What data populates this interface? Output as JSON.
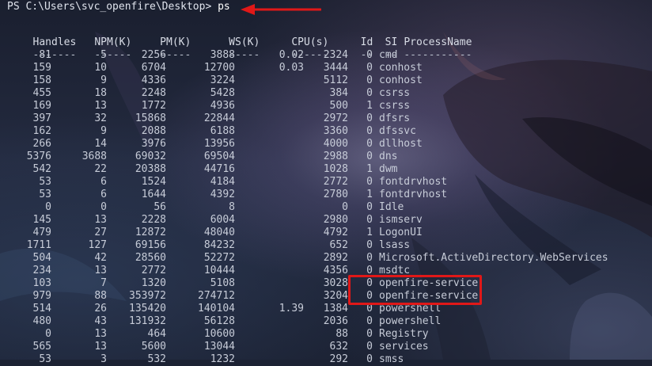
{
  "terminal": {
    "prompt": "PS C:\\Users\\svc_openfire\\Desktop>",
    "command": "ps"
  },
  "table": {
    "headers": [
      "Handles",
      "NPM(K)",
      "PM(K)",
      "WS(K)",
      "CPU(s)",
      "Id",
      "SI",
      "ProcessName"
    ],
    "separators": [
      "-------",
      "------",
      "-----",
      "-----",
      "------",
      "--",
      "--",
      "-----------"
    ],
    "rows": [
      [
        "81",
        "5",
        "2256",
        "3888",
        "0.02",
        "2324",
        "0",
        "cmd"
      ],
      [
        "159",
        "10",
        "6704",
        "12700",
        "0.03",
        "3444",
        "0",
        "conhost"
      ],
      [
        "158",
        "9",
        "4336",
        "3224",
        "",
        "5112",
        "0",
        "conhost"
      ],
      [
        "455",
        "18",
        "2248",
        "5428",
        "",
        "384",
        "0",
        "csrss"
      ],
      [
        "169",
        "13",
        "1772",
        "4936",
        "",
        "500",
        "1",
        "csrss"
      ],
      [
        "397",
        "32",
        "15868",
        "22844",
        "",
        "2972",
        "0",
        "dfsrs"
      ],
      [
        "162",
        "9",
        "2088",
        "6188",
        "",
        "3360",
        "0",
        "dfssvc"
      ],
      [
        "266",
        "14",
        "3976",
        "13956",
        "",
        "4000",
        "0",
        "dllhost"
      ],
      [
        "5376",
        "3688",
        "69032",
        "69504",
        "",
        "2988",
        "0",
        "dns"
      ],
      [
        "542",
        "22",
        "20388",
        "44716",
        "",
        "1028",
        "1",
        "dwm"
      ],
      [
        "53",
        "6",
        "1524",
        "4184",
        "",
        "2772",
        "0",
        "fontdrvhost"
      ],
      [
        "53",
        "6",
        "1644",
        "4392",
        "",
        "2780",
        "1",
        "fontdrvhost"
      ],
      [
        "0",
        "0",
        "56",
        "8",
        "",
        "0",
        "0",
        "Idle"
      ],
      [
        "145",
        "13",
        "2228",
        "6004",
        "",
        "2980",
        "0",
        "ismserv"
      ],
      [
        "479",
        "27",
        "12872",
        "48040",
        "",
        "4792",
        "1",
        "LogonUI"
      ],
      [
        "1711",
        "127",
        "69156",
        "84232",
        "",
        "652",
        "0",
        "lsass"
      ],
      [
        "504",
        "42",
        "28560",
        "52272",
        "",
        "2892",
        "0",
        "Microsoft.ActiveDirectory.WebServices"
      ],
      [
        "234",
        "13",
        "2772",
        "10444",
        "",
        "4356",
        "0",
        "msdtc"
      ],
      [
        "103",
        "7",
        "1320",
        "5108",
        "",
        "3028",
        "0",
        "openfire-service"
      ],
      [
        "979",
        "88",
        "353972",
        "274712",
        "",
        "3204",
        "0",
        "openfire-service"
      ],
      [
        "514",
        "26",
        "135420",
        "140104",
        "1.39",
        "1384",
        "0",
        "powershell"
      ],
      [
        "480",
        "43",
        "131932",
        "56128",
        "",
        "2036",
        "0",
        "powershell"
      ],
      [
        "0",
        "13",
        "464",
        "10600",
        "",
        "88",
        "0",
        "Registry"
      ],
      [
        "565",
        "13",
        "5600",
        "13044",
        "",
        "632",
        "0",
        "services"
      ],
      [
        "53",
        "3",
        "532",
        "1232",
        "",
        "292",
        "0",
        "smss"
      ]
    ]
  },
  "annotations": {
    "arrow_color": "#e01818",
    "highlight_color": "#e01818"
  }
}
